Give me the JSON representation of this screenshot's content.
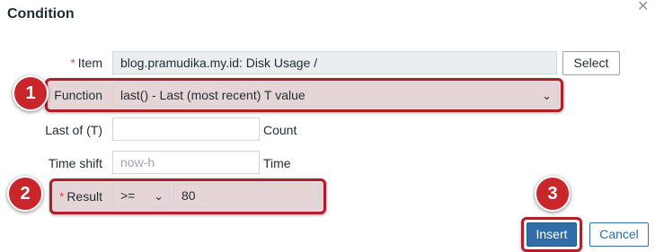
{
  "dialog": {
    "title": "Condition",
    "close_icon": "close-icon",
    "close_glyph": "✕"
  },
  "form": {
    "item": {
      "required_marker": "*",
      "label": "Item",
      "value": "blog.pramudika.my.id: Disk Usage /",
      "select_label": "Select"
    },
    "function": {
      "label": "Function",
      "value": "last() - Last (most recent) T value",
      "chevron_glyph": "⌄"
    },
    "last_of": {
      "label": "Last of (T)",
      "value": "",
      "unit": "Count"
    },
    "time_shift": {
      "label": "Time shift",
      "placeholder": "now-h",
      "unit": "Time"
    },
    "result": {
      "required_marker": "*",
      "label": "Result",
      "operator": ">=",
      "chevron_glyph": "⌄",
      "value": "80"
    }
  },
  "buttons": {
    "insert_label": "Insert",
    "cancel_label": "Cancel"
  },
  "annotations": {
    "badge_1": "1",
    "badge_2": "2",
    "badge_3": "3",
    "accent_color": "#c8262b",
    "highlight_color": "#b01e2b"
  }
}
